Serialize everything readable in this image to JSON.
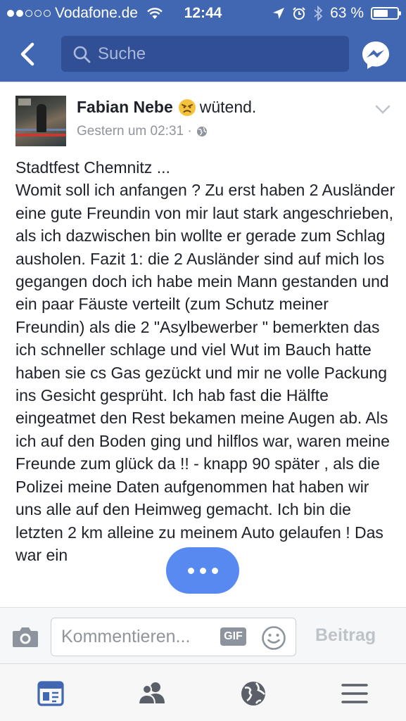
{
  "status_bar": {
    "carrier": "Vodafone.de",
    "time": "12:44",
    "battery_text": "63 %",
    "battery_level": 0.63,
    "signal_bars": 2
  },
  "nav": {
    "search_placeholder": "Suche",
    "accent": "#4267b2"
  },
  "post": {
    "author": "Fabian Nebe",
    "feeling": "wütend.",
    "timestamp": "Gestern um 02:31 ·",
    "text": "Stadtfest Chemnitz ...\nWomit soll ich anfangen ? Zu erst haben 2 Ausländer eine gute Freundin von mir laut stark angeschrieben, als ich dazwischen bin wollte er gerade zum Schlag ausholen. Fazit 1: die 2 Ausländer sind auf mich los gegangen doch ich habe mein Mann gestanden und ein paar Fäuste verteilt (zum Schutz meiner Freundin) als die 2 \"Asylbewerber \" bemerkten das ich schneller schlage und viel Wut im Bauch hatte haben sie cs Gas gezückt und mir ne volle Packung ins Gesicht gesprüht. Ich hab fast die Hälfte eingeatmet den Rest bekamen meine Augen ab. Als ich auf den Boden ging und hilflos war, waren meine Freunde zum glück da !! - knapp 90 später , als die Polizei meine Daten aufgenommen hat haben wir uns alle auf den Heimweg gemacht. Ich bin die letzten 2 km alleine zu meinem Auto gelaufen ! Das war ein"
  },
  "comment": {
    "placeholder": "Kommentieren...",
    "gif_label": "GIF",
    "submit_label": "Beitrag"
  },
  "tabs": [
    {
      "icon": "news-feed-icon",
      "active": true
    },
    {
      "icon": "friends-icon",
      "active": false
    },
    {
      "icon": "globe-notifications-icon",
      "active": false
    },
    {
      "icon": "menu-icon",
      "active": false
    }
  ]
}
